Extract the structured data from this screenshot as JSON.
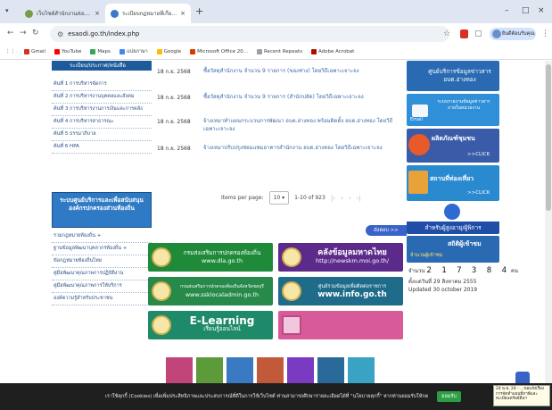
{
  "browser": {
    "tabs": [
      {
        "title": "เว็บไซต์สำนักงานส่งเสริมการปก",
        "active": false
      },
      {
        "title": "ระเบียบกฎหมายที่เกี่ยวข้องกับสำนัก",
        "active": true
      }
    ],
    "new_tab": "+",
    "window_controls": [
      "–",
      "□",
      "×"
    ],
    "url": "esaodi.go.th/index.php",
    "profile_label": "ยินดีต้อนรับคุณ",
    "bookmarks": [
      {
        "label": "Gmail",
        "color": "#d93025"
      },
      {
        "label": "YouTube",
        "color": "#ff0000"
      },
      {
        "label": "Maps",
        "color": "#34a853"
      },
      {
        "label": "แปลภาษา",
        "color": "#4285f4"
      },
      {
        "label": "Google",
        "color": "#fbbc05"
      },
      {
        "label": "Microsoft Office 20...",
        "color": "#d83b01"
      },
      {
        "label": "Recent Repeats",
        "color": "#9aa0a6"
      },
      {
        "label": "Adobe Acrobat",
        "color": "#b30b00"
      }
    ]
  },
  "sidebar": {
    "header": "ระเบียบ/ประกาศ/หนังสือ",
    "items": [
      "ค้นที่ 1 การบริหารจัดการ",
      "ค้นที่ 2 การบริหารงานบุคคลและสังคม",
      "ค้นที่ 3 การบริหารงานการเงินและการคลัง",
      "ค้นที่ 4 การบริหารสาธารณะ",
      "ค้นที่ 5 ธรรมาภิบาล",
      "ค้นที่ 6 HPA"
    ],
    "banner": "ระบบศูนย์บริการและเพื่อสนับสนุนองค์กรปกครองส่วนท้องถิ่น",
    "items2": [
      "รวมกฎหมายท้องถิ่น +",
      "ฐานข้อมูลพัฒนาบุคลากรท้องถิ่น +",
      "ข้อกฎหมายท้องถิ่นไทย",
      "คู่มือพัฒนาคุณภาพการปฏิบัติงาน",
      "คู่มือพัฒนาคุณภาพการให้บริการ",
      "องค์ความรู้สำหรับประชาชน"
    ]
  },
  "table": {
    "rows": [
      {
        "date": "18 ก.ย. 2568",
        "text": "ซื้อวัสดุสำนักงาน จำนวน 9 รายการ (ของช่าง) โดยวิธีเฉพาะเจาะจง"
      },
      {
        "date": "18 ก.ย. 2568",
        "text": "ซื้อวัสดุสำนักงาน จำนวน 9 รายการ (สำนักปลัด) โดยวิธีเฉพาะเจาะจง"
      },
      {
        "date": "18 ก.ย. 2568",
        "text": "จ้างเหมาทำแผนกระบวนการพัฒนา อบต.อ่างทอง พร้อมติดตั้ง อบต.อ่างทอง โดยวิธีเฉพาะเจาะจง"
      },
      {
        "date": "18 ก.ย. 2568",
        "text": "จ้างเหมาปรับปรุงซ่อมแซมอาคารสำนักงาน อบต.อ่างทอง โดยวิธีเฉพาะเจาะจง"
      }
    ],
    "pager": {
      "items_label": "Items per page:",
      "per_page": "10",
      "range": "1-10 of 923"
    },
    "more_button": "ดังตอบ >>"
  },
  "banners": [
    {
      "title": "กรมส่งเสริมการปกครองท้องถิ่น",
      "sub": "www.dla.go.th",
      "color": "#1f8a3a"
    },
    {
      "title": "คลังข้อมูลมหาดไทย",
      "sub": "http://newskm.moi.go.th/",
      "color": "#5c2a8a"
    },
    {
      "title": "กรมส่งเสริมการปกครองท้องถิ่นจังหวัดชลบุรี",
      "sub": "www.ssklocaladmin.go.th",
      "color": "#27894a"
    },
    {
      "title": "ศูนย์รวมข้อมูลเพื่อติดต่อราชการ",
      "sub": "www.info.go.th",
      "color": "#1f6b8a"
    },
    {
      "title": "E-Learning",
      "sub": "เรียนรู้ออนไลน์",
      "color": "#1f8a6a"
    },
    {
      "title": "",
      "sub": "",
      "color": "#d85a9a"
    }
  ],
  "right": {
    "box1": "ศูนย์บริการข้อมูลข่าวสาร อบต.อ่างทอง",
    "email_label": "Email",
    "email_text": "ระบบรายงานข้อมูลข่าวสารภายในหน่วยงาน",
    "otop": "ผลิตภัณฑ์ชุมชน",
    "click": ">>CLICK",
    "tourism": "สถานที่ท่องเที่ยว",
    "elder": "สำหรับผู้สูงอายุ/ผู้พิการ",
    "counter_title": "สถิติผู้เข้าชม",
    "counter_label": "จำนวนผู้เข้าชม",
    "counter_prefix": "จำนวน",
    "counter_value": "2 1 7 3 8 4",
    "counter_unit": "คน",
    "since": "ตั้งแต่วันที่ 29 สิงหาคม 2555",
    "updated": "Updated 30 october 2019"
  },
  "cookie": {
    "text": "เราใช้คุกกี้ (Cookies) เพื่อเพิ่มประสิทธิภาพและประสบการณ์ที่ดีในการใช้เว็บไซต์ ท่านสามารถศึกษารายละเอียดได้ที่ \"นโยบายคุกกี้\" หากท่านยอมรับให้กด",
    "accept": "ยอมรับ"
  },
  "note": "24 พ.ย. 24 - ...ขอแจ้งเรื่องการจัดทำแผนที่ภาษีและทะเบียนทรัพย์สินฯ"
}
